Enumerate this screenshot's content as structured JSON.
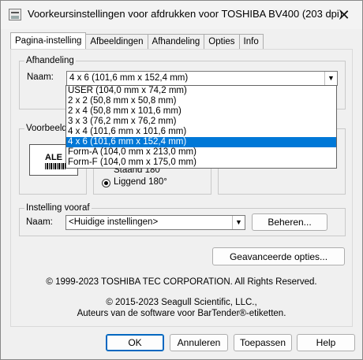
{
  "window": {
    "title": "Voorkeursinstellingen voor afdrukken voor TOSHIBA BV400 (203 dpi)",
    "close": "✕"
  },
  "tabs": [
    "Pagina-instelling",
    "Afbeeldingen",
    "Afhandeling",
    "Opties",
    "Info"
  ],
  "afhandeling": {
    "group_label": "Afhandeling",
    "naam_label": "Naam:",
    "selected": "4 x 6 (101,6 mm x 152,4 mm)",
    "options": [
      "USER (104,0 mm x 74,2 mm)",
      "2 x 2 (50,8 mm x 50,8 mm)",
      "2 x 4 (50,8 mm x 101,6 mm)",
      "3 x 3 (76,2 mm x 76,2 mm)",
      "4 x 4 (101,6 mm x 101,6 mm)",
      "4 x 6 (101,6 mm x 152,4 mm)",
      "Form-A (104,0 mm x 213,0 mm)",
      "Form-F (104,0 mm x 175,0 mm)"
    ],
    "highlighted_index": 5
  },
  "voorbeeld": {
    "group_label": "Voorbeeld",
    "preview_text": "ALE"
  },
  "orientatie": {
    "staand": "Staand 180°",
    "liggend": "Liggend 180°"
  },
  "instelling": {
    "group_label": "Instelling vooraf",
    "naam_label": "Naam:",
    "selected": "<Huidige instellingen>",
    "beheren": "Beheren..."
  },
  "geavanceerd": "Geavanceerde opties...",
  "copyright1": "© 1999-2023 TOSHIBA TEC CORPORATION.  All Rights Reserved.",
  "copyright2": "© 2015-2023 Seagull Scientific, LLC.,",
  "copyright3": "Auteurs van de software voor BarTender®-etiketten.",
  "buttons": {
    "ok": "OK",
    "annuleren": "Annuleren",
    "toepassen": "Toepassen",
    "help": "Help"
  }
}
